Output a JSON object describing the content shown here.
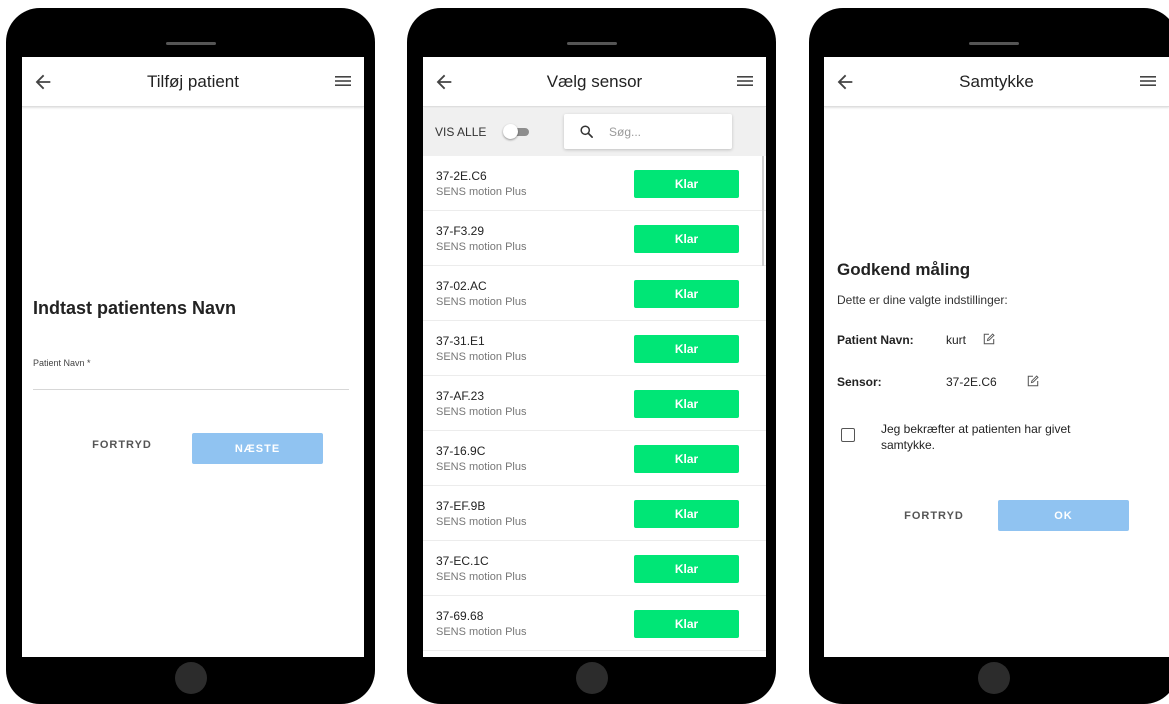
{
  "screen1": {
    "title": "Tilføj patient",
    "heading": "Indtast patientens Navn",
    "field_label": "Patient Navn *",
    "field_value": "",
    "cancel_label": "FORTRYD",
    "next_label": "NÆSTE"
  },
  "screen2": {
    "title": "Vælg sensor",
    "show_all_label": "VIS ALLE",
    "show_all_on": false,
    "search_placeholder": "Søg...",
    "sensors": [
      {
        "id": "37-2E.C6",
        "type": "SENS motion Plus",
        "status": "Klar"
      },
      {
        "id": "37-F3.29",
        "type": "SENS motion Plus",
        "status": "Klar"
      },
      {
        "id": "37-02.AC",
        "type": "SENS motion Plus",
        "status": "Klar"
      },
      {
        "id": "37-31.E1",
        "type": "SENS motion Plus",
        "status": "Klar"
      },
      {
        "id": "37-AF.23",
        "type": "SENS motion Plus",
        "status": "Klar"
      },
      {
        "id": "37-16.9C",
        "type": "SENS motion Plus",
        "status": "Klar"
      },
      {
        "id": "37-EF.9B",
        "type": "SENS motion Plus",
        "status": "Klar"
      },
      {
        "id": "37-EC.1C",
        "type": "SENS motion Plus",
        "status": "Klar"
      },
      {
        "id": "37-69.68",
        "type": "SENS motion Plus",
        "status": "Klar"
      }
    ]
  },
  "screen3": {
    "title": "Samtykke",
    "heading": "Godkend måling",
    "subtitle": "Dette er dine valgte indstillinger:",
    "patient_label": "Patient Navn:",
    "patient_value": "kurt",
    "sensor_label": "Sensor:",
    "sensor_value": "37-2E.C6",
    "consent_text": "Jeg bekræfter at patienten har givet samtykke.",
    "consent_checked": false,
    "cancel_label": "FORTRYD",
    "ok_label": "OK"
  },
  "colors": {
    "primary_disabled": "#90c3f1",
    "ready": "#00e676",
    "device": "#000000"
  },
  "icons": {
    "back": "arrow-left-icon",
    "menu": "hamburger-menu-icon",
    "search": "search-icon",
    "edit": "edit-icon",
    "checkbox": "checkbox-icon"
  }
}
